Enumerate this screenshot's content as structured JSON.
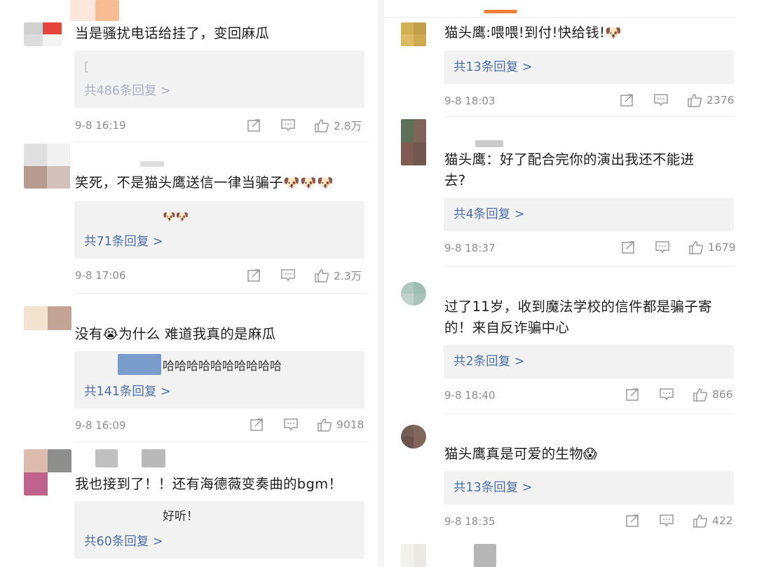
{
  "left": [
    {
      "text": "当是骚扰电话给挂了，变回麻瓜",
      "reply_preview": "[",
      "reply_count": "共486条回复 >",
      "time": "9-8 16:19",
      "likes": "2.8万",
      "avatar_colors": [
        "#c9c9c9",
        "#e2231a",
        "#d8d8d8",
        "#f3f3f3"
      ],
      "name_colors": [
        "#f4b79a",
        "#f6a06a"
      ]
    },
    {
      "text": "笑死，不是猫头鹰送信一律当骗子",
      "reply_preview": "",
      "reply_count": "共71条回复 >",
      "time": "9-8 17:06",
      "likes": "2.3万",
      "avatar_colors": [
        "#dadada",
        "#efefef",
        "#a98a7d",
        "#c9b7ae"
      ],
      "name_colors": [
        "#bfbfbf"
      ]
    },
    {
      "text": "没有",
      "text_after": "为什么 难道我真的是麻瓜",
      "reply_preview": "哈哈哈哈哈哈哈哈哈哈",
      "reply_count": "共141条回复 >",
      "time": "9-8 16:09",
      "likes": "9018",
      "avatar_colors": [
        "#f0dfc9",
        "#b89384",
        "#ffffff",
        "#ffffff"
      ],
      "name_colors": [
        "#5b86c1"
      ]
    },
    {
      "text": "我也接到了！！还有海德薇变奏曲的bgm！",
      "reply_preview": "好听！",
      "reply_count": "共60条回复 >",
      "time": "",
      "likes": "",
      "avatar_colors": [
        "#d8b0a0",
        "#7b7b7b",
        "#b24878",
        "#ffffff"
      ],
      "name_colors": [
        "#8c8c8c",
        "#7f7f7f"
      ]
    }
  ],
  "right": [
    {
      "text": "猫头鹰:喂喂!到付!快给钱!",
      "reply_count": "共13条回复 >",
      "time": "9-8 18:03",
      "likes": "2376",
      "avatar_colors": [
        "#c9a236",
        "#b88f27",
        "#d6b04b",
        "#c59c31"
      ]
    },
    {
      "text": "猫头鹰：好了配合完你的演出我还不能进",
      "text_line2": "去?",
      "reply_count": "共4条回复 >",
      "time": "9-8 18:37",
      "likes": "1679",
      "avatar_colors": [
        "#3f5a3c",
        "#6b4a3e",
        "#6a3f35",
        "#5a3a33"
      ],
      "name_colors": [
        "#9e9e9e"
      ]
    },
    {
      "text": "过了11岁，收到魔法学校的信件都是骗子寄",
      "text_line2": "的！来自反诈骗中心",
      "reply_count": "共2条回复 >",
      "time": "9-8 18:40",
      "likes": "866",
      "avatar_colors": [
        "#a3c0b6",
        "#8fb3a6",
        "#b5cbc4",
        "#9bb9ae"
      ]
    },
    {
      "text": "猫头鹰真是可爱的生物",
      "reply_count": "共13条回复 >",
      "time": "9-8 18:35",
      "likes": "422",
      "avatar_colors": [
        "#5c4137",
        "#6d4d40",
        "#4e362e",
        "#6a4a3d"
      ]
    }
  ],
  "emoji_doge": "🐶",
  "emoji_cry": "😭",
  "emoji_scream": "😱"
}
